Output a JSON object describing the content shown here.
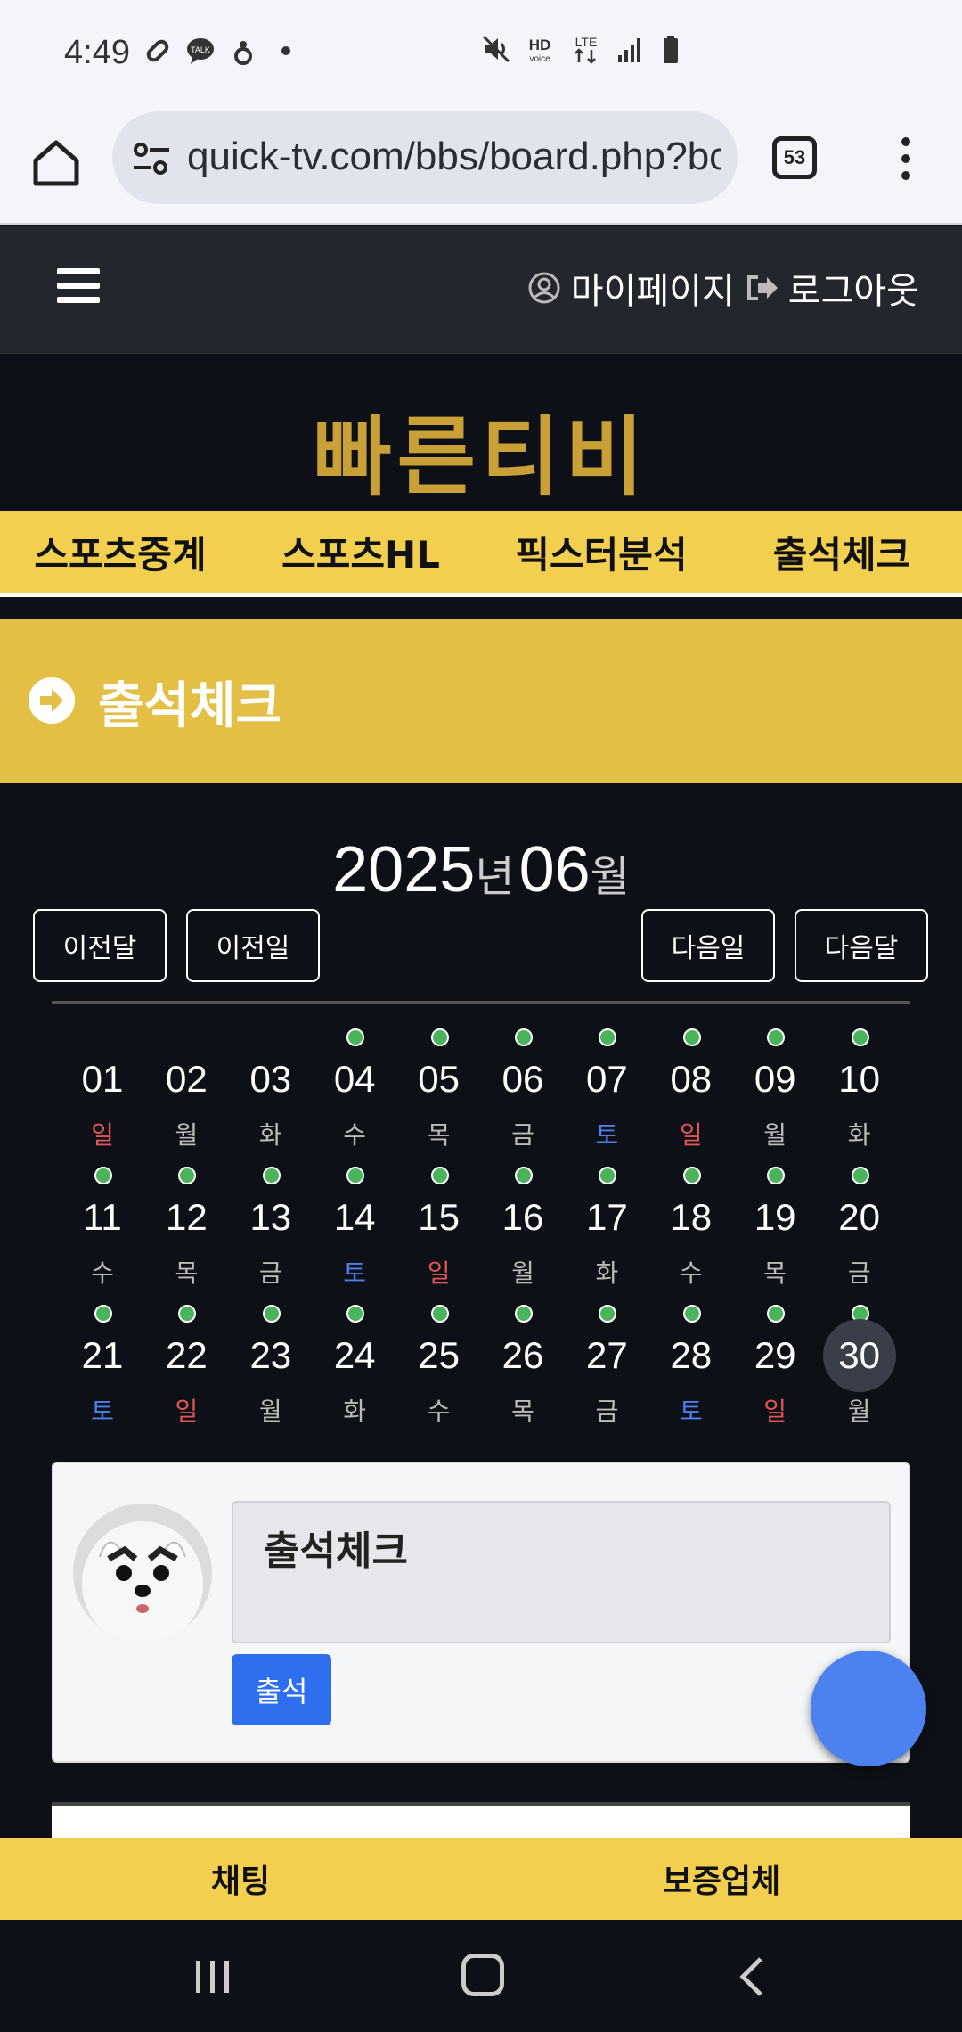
{
  "status_bar": {
    "time": "4:49",
    "left_icons": [
      "link-icon",
      "talk-chat-icon",
      "person-alert-icon",
      "dot-icon"
    ],
    "right_icons": [
      "mute-icon",
      "hd-voice-icon",
      "lte-icon",
      "signal-icon",
      "battery-icon"
    ]
  },
  "browser": {
    "url": "quick-tv.com/bbs/board.php?bo",
    "tab_count": "53"
  },
  "header": {
    "mypage_label": "마이페이지",
    "logout_label": "로그아웃"
  },
  "logo": {
    "text": "빠른티비",
    "color": "#c9a035"
  },
  "nav": {
    "items": [
      {
        "label": "스포츠중계"
      },
      {
        "label": "스포츠HL"
      },
      {
        "label": "픽스터분석"
      },
      {
        "label": "출석체크"
      }
    ]
  },
  "banner": {
    "title": "출석체크",
    "color": "#e4bf45"
  },
  "calendar": {
    "year": "2025",
    "year_suffix": "년",
    "month": "06",
    "month_suffix": "월",
    "buttons": {
      "prev_month": "이전달",
      "prev_day": "이전일",
      "next_day": "다음일",
      "next_month": "다음달"
    },
    "today": "30",
    "days": [
      {
        "day": "01",
        "weekday": "일",
        "attended": false
      },
      {
        "day": "02",
        "weekday": "월",
        "attended": false
      },
      {
        "day": "03",
        "weekday": "화",
        "attended": false
      },
      {
        "day": "04",
        "weekday": "수",
        "attended": true
      },
      {
        "day": "05",
        "weekday": "목",
        "attended": true
      },
      {
        "day": "06",
        "weekday": "금",
        "attended": true
      },
      {
        "day": "07",
        "weekday": "토",
        "attended": true
      },
      {
        "day": "08",
        "weekday": "일",
        "attended": true
      },
      {
        "day": "09",
        "weekday": "월",
        "attended": true
      },
      {
        "day": "10",
        "weekday": "화",
        "attended": true
      },
      {
        "day": "11",
        "weekday": "수",
        "attended": true
      },
      {
        "day": "12",
        "weekday": "목",
        "attended": true
      },
      {
        "day": "13",
        "weekday": "금",
        "attended": true
      },
      {
        "day": "14",
        "weekday": "토",
        "attended": true
      },
      {
        "day": "15",
        "weekday": "일",
        "attended": true
      },
      {
        "day": "16",
        "weekday": "월",
        "attended": true
      },
      {
        "day": "17",
        "weekday": "화",
        "attended": true
      },
      {
        "day": "18",
        "weekday": "수",
        "attended": true
      },
      {
        "day": "19",
        "weekday": "목",
        "attended": true
      },
      {
        "day": "20",
        "weekday": "금",
        "attended": true
      },
      {
        "day": "21",
        "weekday": "토",
        "attended": true
      },
      {
        "day": "22",
        "weekday": "일",
        "attended": true
      },
      {
        "day": "23",
        "weekday": "월",
        "attended": true
      },
      {
        "day": "24",
        "weekday": "화",
        "attended": true
      },
      {
        "day": "25",
        "weekday": "수",
        "attended": true
      },
      {
        "day": "26",
        "weekday": "목",
        "attended": true
      },
      {
        "day": "27",
        "weekday": "금",
        "attended": true
      },
      {
        "day": "28",
        "weekday": "토",
        "attended": true
      },
      {
        "day": "29",
        "weekday": "일",
        "attended": true
      },
      {
        "day": "30",
        "weekday": "월",
        "attended": true
      }
    ],
    "colors": {
      "sunday": "#e05557",
      "saturday": "#4c80f0",
      "attended_dot": "#4ab45a"
    }
  },
  "attendance_form": {
    "memo_value": "출석체크",
    "submit_label": "출석"
  },
  "bottom_bar": {
    "chat_label": "채팅",
    "partner_label": "보증업체"
  }
}
